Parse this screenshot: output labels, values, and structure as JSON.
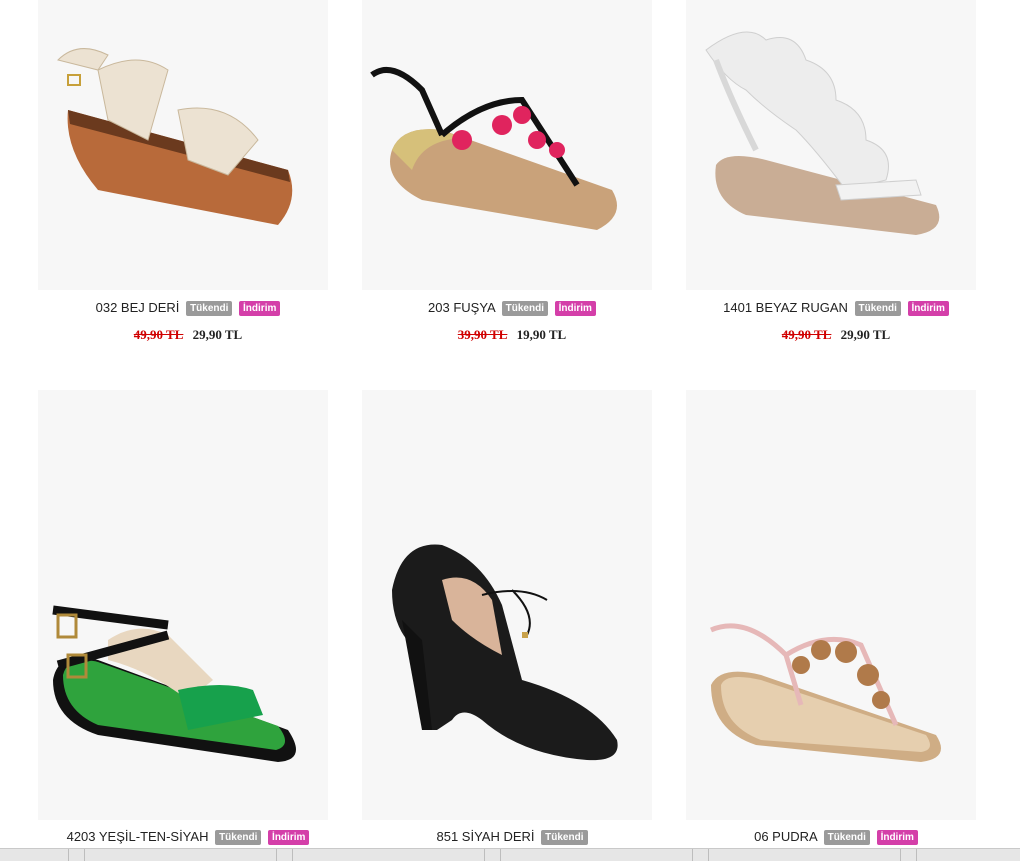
{
  "products": [
    {
      "name": "032 BEJ DERİ",
      "soldout": "Tükendi",
      "sale": "İndirim",
      "old_price": "49,90 TL",
      "new_price": "29,90 TL",
      "icon": "beige-wedge-sandal-image"
    },
    {
      "name": "203 FUŞYA",
      "soldout": "Tükendi",
      "sale": "İndirim",
      "old_price": "39,90 TL",
      "new_price": "19,90 TL",
      "icon": "fuchsia-starfish-sandal-image"
    },
    {
      "name": "1401 BEYAZ RUGAN",
      "soldout": "Tükendi",
      "sale": "İndirim",
      "old_price": "49,90 TL",
      "new_price": "29,90 TL",
      "icon": "white-wing-sandal-image"
    },
    {
      "name": "4203 YEŞİL-TEN-SİYAH",
      "soldout": "Tükendi",
      "sale": "İndirim",
      "icon": "green-black-sandal-image"
    },
    {
      "name": "851 SİYAH DERİ",
      "soldout": "Tükendi",
      "icon": "black-heel-shoe-image"
    },
    {
      "name": "06 PUDRA",
      "soldout": "Tükendi",
      "sale": "İndirim",
      "icon": "powder-jewel-sandal-image"
    }
  ],
  "colors": {
    "sale_badge": "#d43fa9",
    "soldout_badge": "#9a9a9a",
    "old_price": "#d00000"
  }
}
